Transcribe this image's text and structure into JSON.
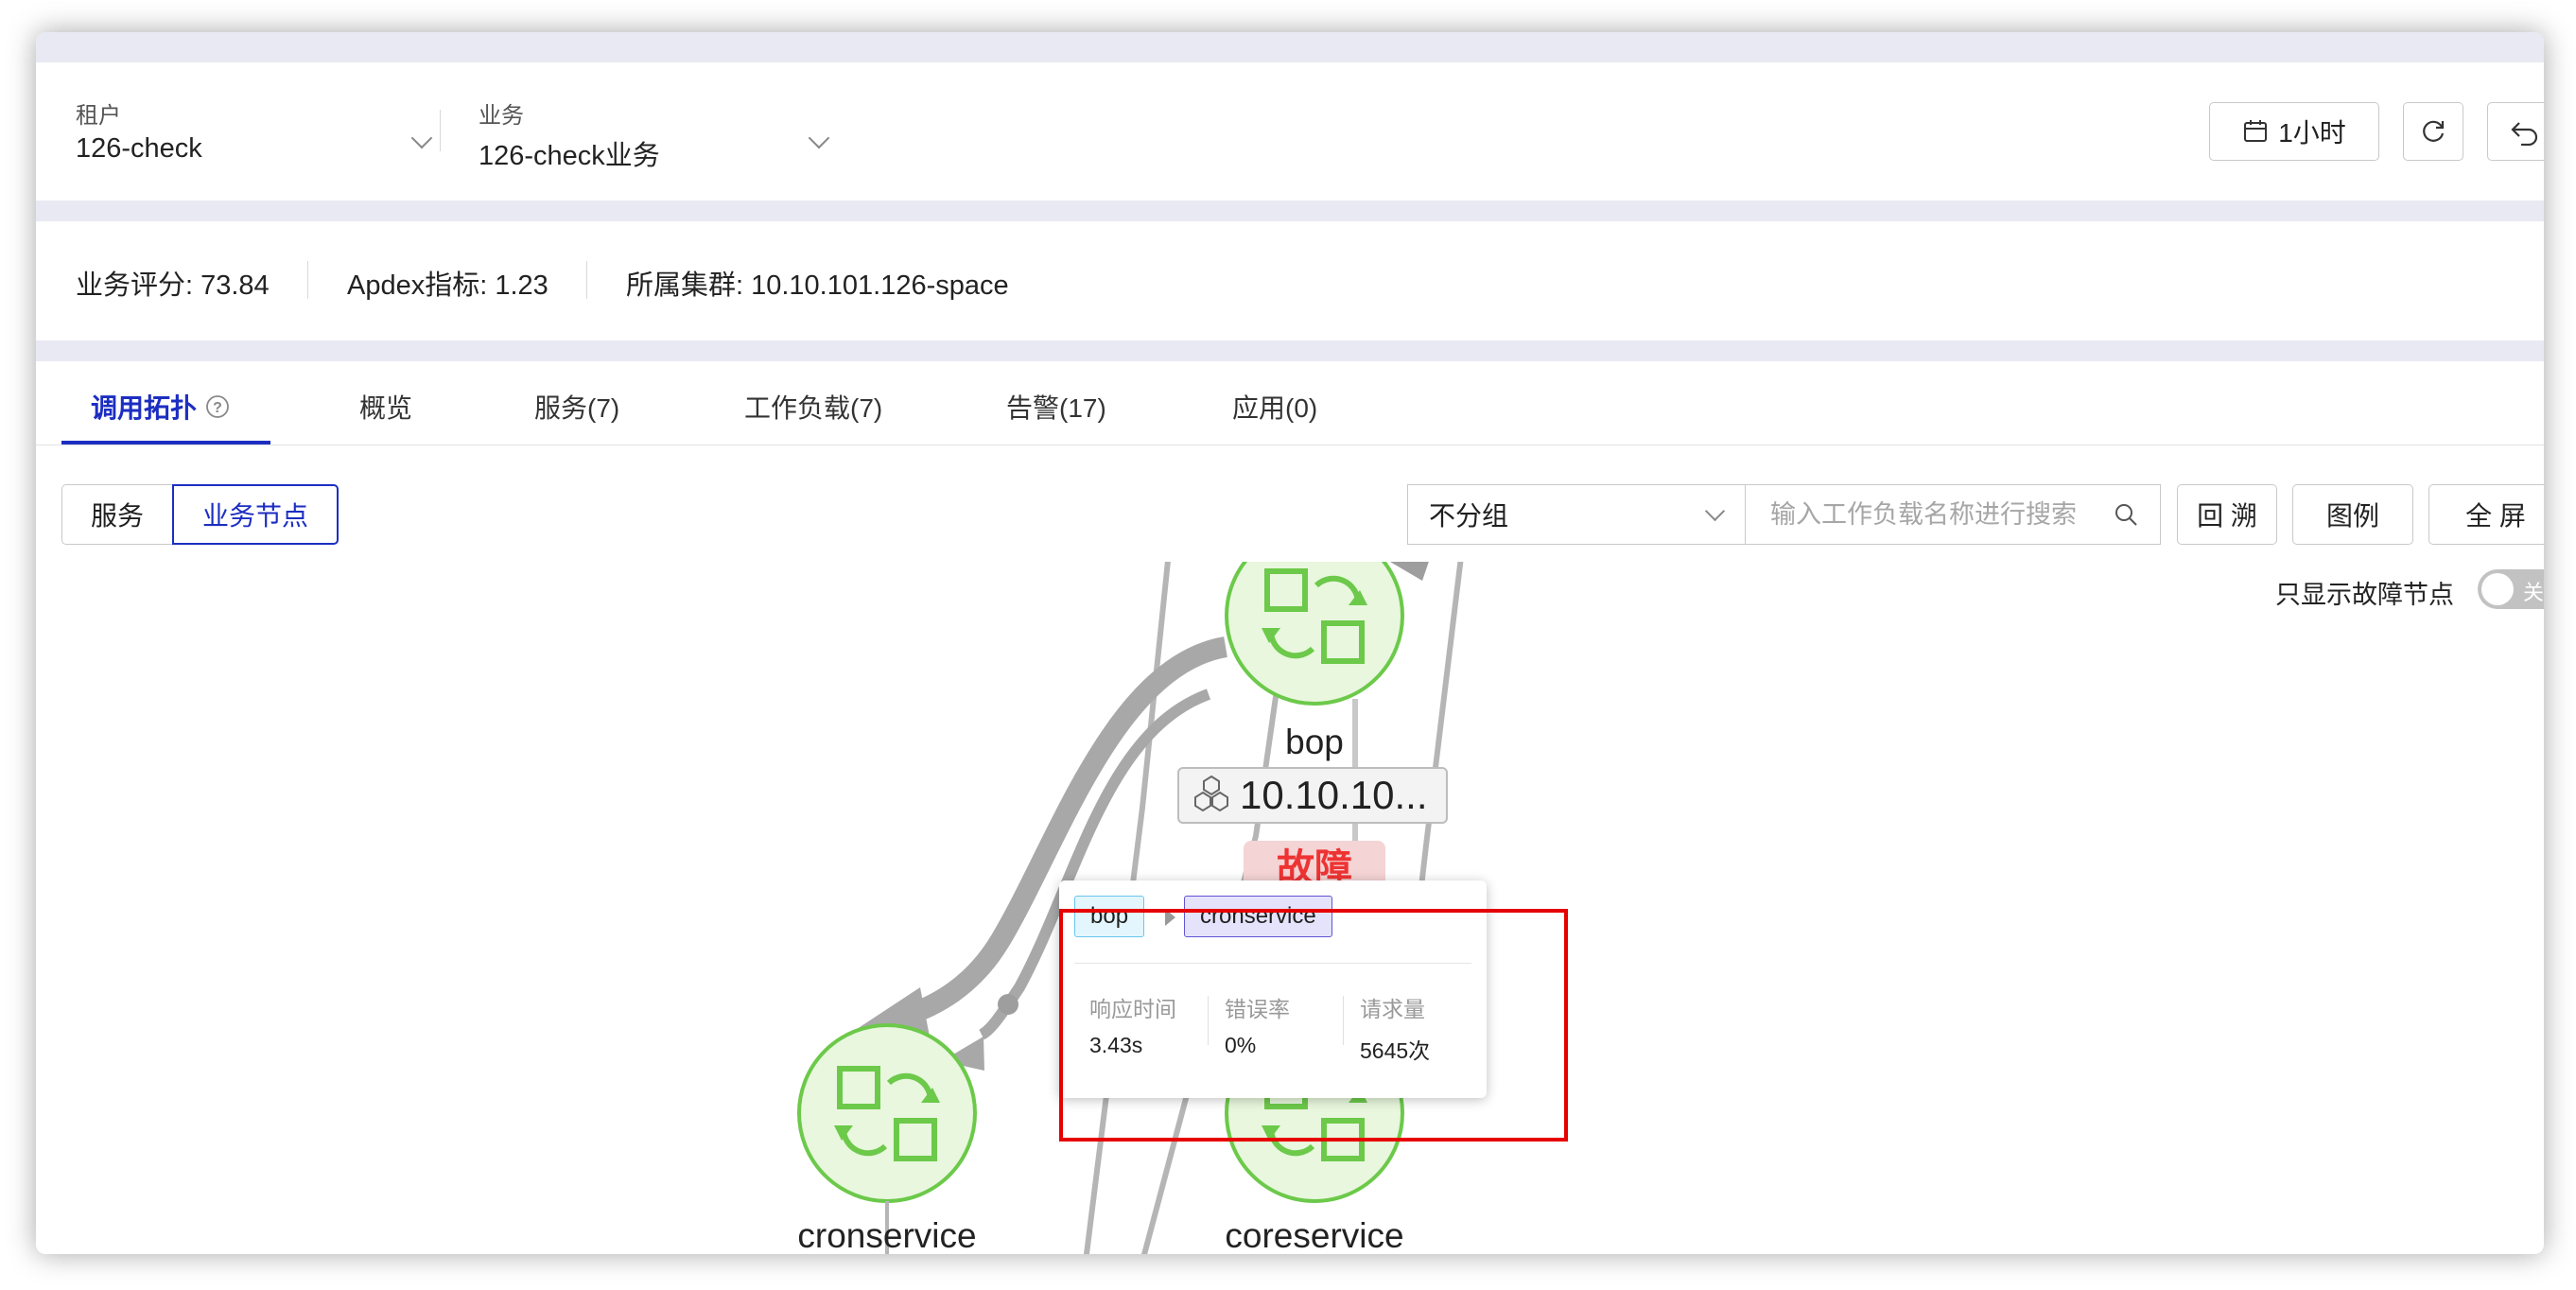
{
  "header": {
    "tenant": {
      "label": "租户",
      "value": "126-check"
    },
    "business": {
      "label": "业务",
      "value": "126-check业务"
    },
    "time_range": "1小时"
  },
  "metrics": {
    "score": "业务评分: 73.84",
    "apdex": "Apdex指标: 1.23",
    "cluster": "所属集群: 10.10.101.126-space"
  },
  "tabs": [
    {
      "label": "调用拓扑",
      "active": true
    },
    {
      "label": "概览"
    },
    {
      "label": "服务(7)"
    },
    {
      "label": "工作负载(7)"
    },
    {
      "label": "告警(17)"
    },
    {
      "label": "应用(0)"
    }
  ],
  "toolbar": {
    "view_service": "服务",
    "view_business_node": "业务节点",
    "group_select": "不分组",
    "search_placeholder": "输入工作负载名称进行搜索",
    "trace_back": "回 溯",
    "legend": "图例",
    "fullscreen": "全 屏",
    "only_fault_label": "只显示故障节点",
    "toggle_state": "关"
  },
  "topology": {
    "nodes": [
      {
        "name": "bop",
        "ip": "10.10.10...",
        "status": "故障"
      },
      {
        "name": "cronservice"
      },
      {
        "name": "coreservice"
      }
    ],
    "node_color": "#6cc94a"
  },
  "tooltip": {
    "source": "bop",
    "target": "cronservice",
    "response_time_label": "响应时间",
    "response_time": "3.43s",
    "error_rate_label": "错误率",
    "error_rate": "0%",
    "requests_label": "请求量",
    "requests": "5645次"
  },
  "colors": {
    "accent": "#1c2ec1",
    "fault": "#e33333",
    "highlight_box": "#e60000"
  }
}
